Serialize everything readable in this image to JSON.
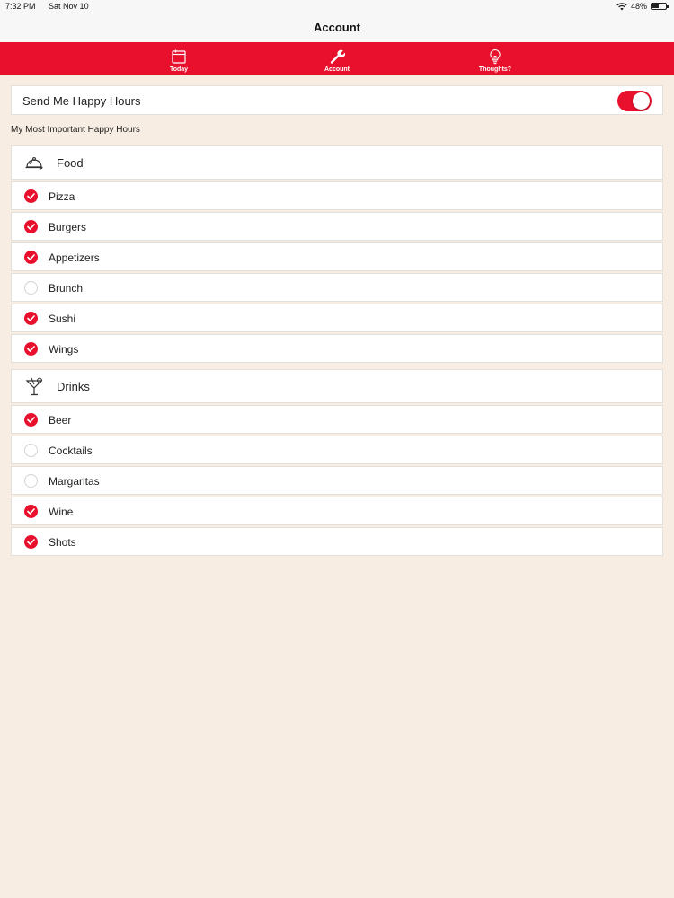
{
  "status_bar": {
    "time": "7:32 PM",
    "date": "Sat Nov 10",
    "battery": "48%",
    "battery_level": 0.48
  },
  "nav": {
    "title": "Account"
  },
  "tabs": [
    {
      "label": "Today",
      "icon": "calendar-icon"
    },
    {
      "label": "Account",
      "icon": "wrench-icon"
    },
    {
      "label": "Thoughts?",
      "icon": "lightbulb-icon"
    }
  ],
  "toggle": {
    "label": "Send Me Happy Hours",
    "on": true
  },
  "section_caption": "My Most Important Happy Hours",
  "food": {
    "title": "Food",
    "icon": "cloche-icon",
    "items": [
      {
        "label": "Pizza",
        "checked": true
      },
      {
        "label": "Burgers",
        "checked": true
      },
      {
        "label": "Appetizers",
        "checked": true
      },
      {
        "label": "Brunch",
        "checked": false
      },
      {
        "label": "Sushi",
        "checked": true
      },
      {
        "label": "Wings",
        "checked": true
      }
    ]
  },
  "drinks": {
    "title": "Drinks",
    "icon": "cocktail-icon",
    "items": [
      {
        "label": "Beer",
        "checked": true
      },
      {
        "label": "Cocktails",
        "checked": false
      },
      {
        "label": "Margaritas",
        "checked": false
      },
      {
        "label": "Wine",
        "checked": true
      },
      {
        "label": "Shots",
        "checked": true
      }
    ]
  },
  "colors": {
    "accent": "#e8102c",
    "background": "#f8ede3"
  }
}
